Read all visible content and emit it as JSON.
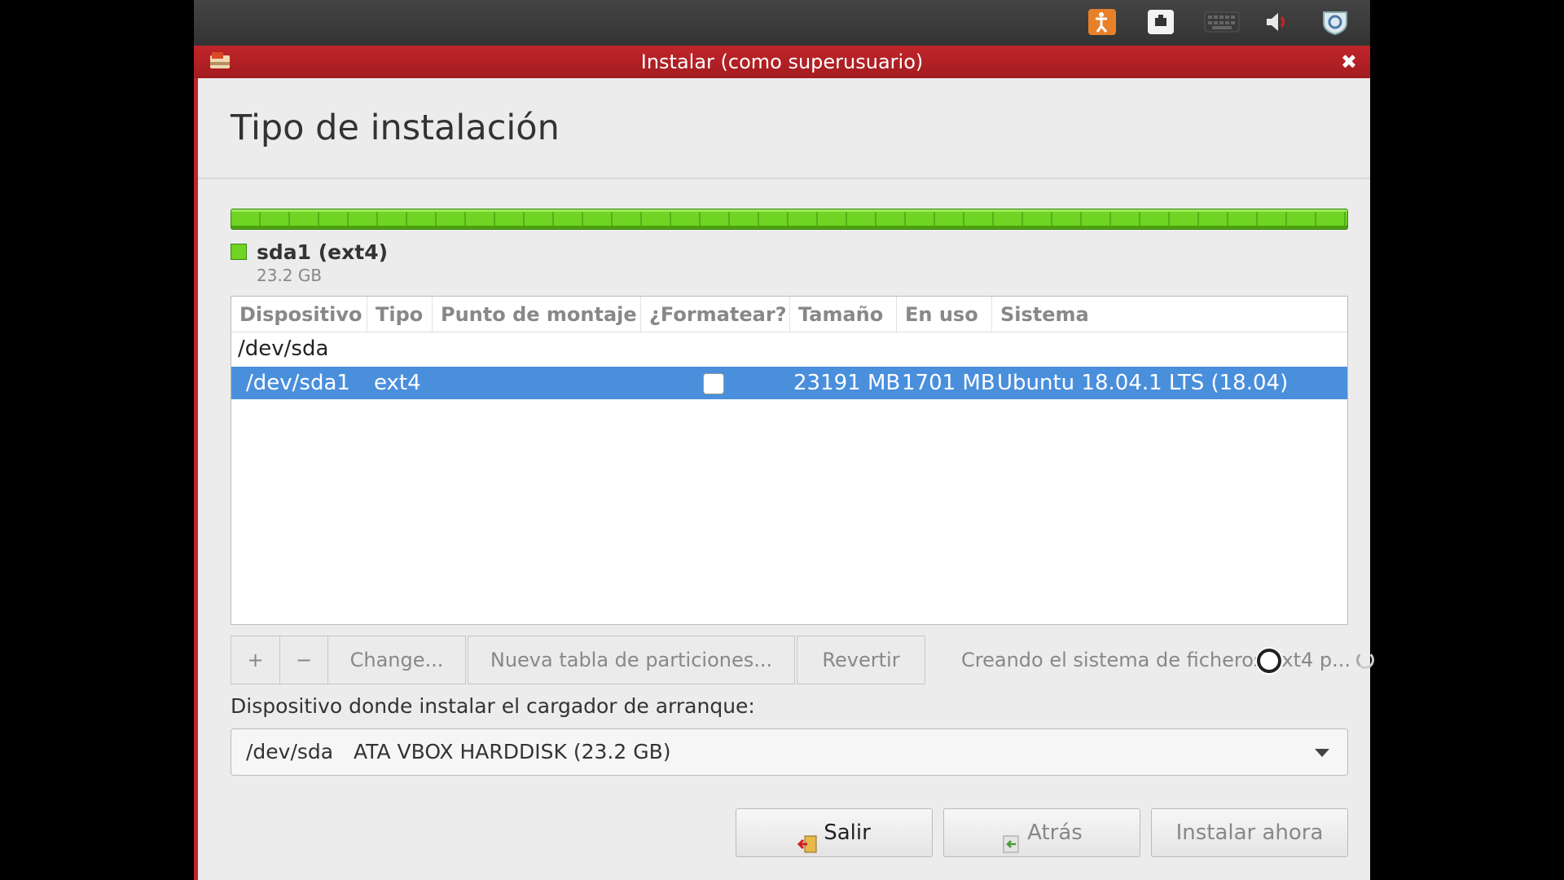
{
  "window": {
    "title": "Instalar (como superusuario)",
    "close_glyph": "✖"
  },
  "page": {
    "title": "Tipo de instalación"
  },
  "partition_bar": {
    "color": "#6fd424",
    "fill_fraction": 1.0
  },
  "legend": {
    "name": "sda1 (ext4)",
    "size": "23.2 GB"
  },
  "table": {
    "headers": [
      "Dispositivo",
      "Tipo",
      "Punto de montaje",
      "¿Formatear?",
      "Tamaño",
      "En uso",
      "Sistema"
    ],
    "disk_row": {
      "device": "/dev/sda"
    },
    "selected_row": {
      "device": "/dev/sda1",
      "type": "ext4",
      "mount": "",
      "format": false,
      "size": "23191 MB",
      "used": "1701 MB",
      "system": "Ubuntu 18.04.1 LTS (18.04)"
    },
    "selected_color": "#4a8fdc"
  },
  "toolbar": {
    "add": "+",
    "remove": "−",
    "change": "Change...",
    "new_table": "Nueva tabla de particiones...",
    "revert": "Revertir",
    "status": "Creando el sistema de ficheros ext4 p..."
  },
  "bootloader": {
    "label": "Dispositivo donde instalar el cargador de arranque:",
    "device": "/dev/sda",
    "description": "ATA VBOX HARDDISK (23.2 GB)"
  },
  "buttons": {
    "quit": "Salir",
    "back": "Atrás",
    "install": "Instalar ahora"
  },
  "tray_icons": [
    "accessibility-icon",
    "network-icon",
    "keyboard-icon",
    "volume-icon",
    "power-icon"
  ]
}
